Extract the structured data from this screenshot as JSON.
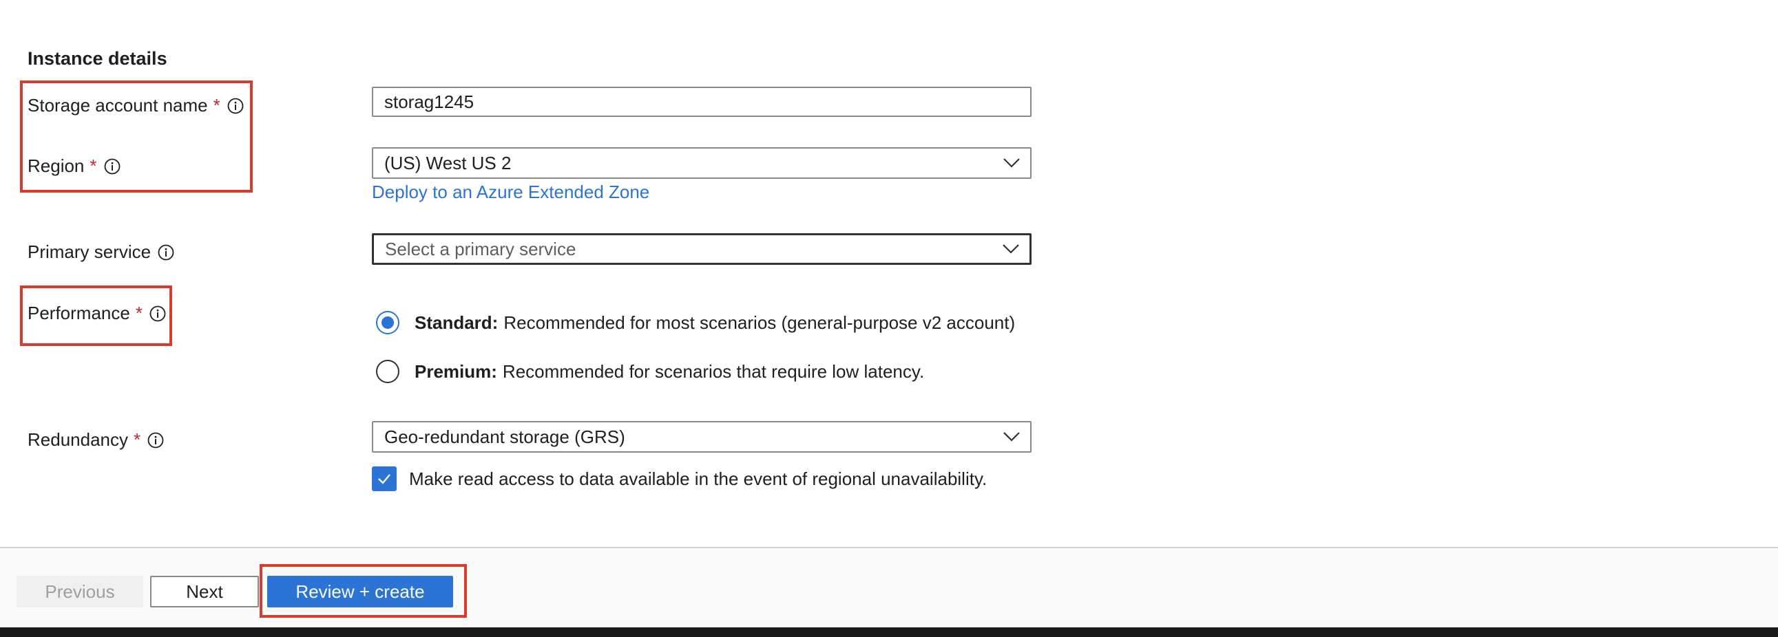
{
  "section": {
    "title": "Instance details"
  },
  "fields": {
    "storage_account_name": {
      "label": "Storage account name",
      "required": "*",
      "value": "storag1245"
    },
    "region": {
      "label": "Region",
      "required": "*",
      "value": "(US) West US 2",
      "link": "Deploy to an Azure Extended Zone"
    },
    "primary_service": {
      "label": "Primary service",
      "placeholder": "Select a primary service"
    },
    "performance": {
      "label": "Performance",
      "required": "*",
      "options": [
        {
          "title": "Standard:",
          "description": "Recommended for most scenarios (general-purpose v2 account)",
          "selected": true
        },
        {
          "title": "Premium:",
          "description": "Recommended for scenarios that require low latency.",
          "selected": false
        }
      ]
    },
    "redundancy": {
      "label": "Redundancy",
      "required": "*",
      "value": "Geo-redundant storage (GRS)",
      "checkbox_label": "Make read access to data available in the event of regional unavailability.",
      "checkbox_checked": true
    }
  },
  "footer": {
    "previous_label": "Previous",
    "next_label": "Next",
    "review_label": "Review + create"
  },
  "colors": {
    "accent": "#2b74d5",
    "required": "#c4262e",
    "highlight": "#d83b2b"
  },
  "icons": [
    "info-icon",
    "chevron-down-icon",
    "checkmark-icon"
  ]
}
